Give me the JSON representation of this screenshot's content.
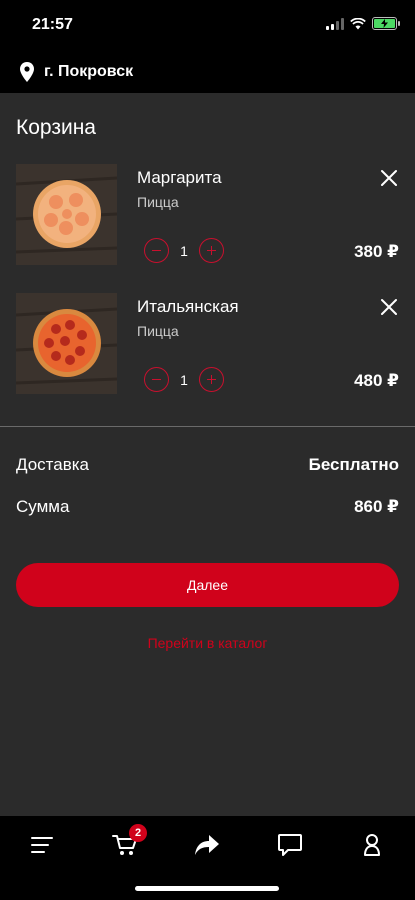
{
  "status_bar": {
    "time": "21:57"
  },
  "location": {
    "city": "г. Покровск"
  },
  "page": {
    "title": "Корзина"
  },
  "cart": {
    "items": [
      {
        "name": "Маргарита",
        "category": "Пицца",
        "quantity": "1",
        "price": "380 ₽"
      },
      {
        "name": "Итальянская",
        "category": "Пицца",
        "quantity": "1",
        "price": "480 ₽"
      }
    ]
  },
  "summary": {
    "delivery_label": "Доставка",
    "delivery_value": "Бесплатно",
    "total_label": "Сумма",
    "total_value": "860 ₽"
  },
  "actions": {
    "next_label": "Далее",
    "catalog_label": "Перейти в каталог"
  },
  "tabbar": {
    "cart_badge": "2",
    "tabs": [
      "menu-icon",
      "cart-icon",
      "share-icon",
      "chat-icon",
      "profile-icon"
    ]
  },
  "colors": {
    "accent": "#d0021b",
    "background": "#2b2b2b",
    "bars": "#000000"
  }
}
